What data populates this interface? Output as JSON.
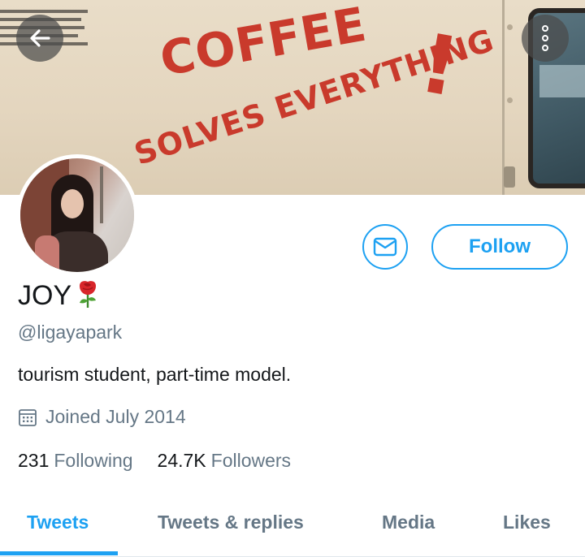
{
  "banner": {
    "slogan_line1": "COFFEE",
    "slogan_line2": "SOLVES EVERYTHING",
    "slogan_mark": "!",
    "slogan_color": "#c93a2c"
  },
  "nav": {
    "back_icon": "arrow-left-icon",
    "more_icon": "more-vertical-icon"
  },
  "profile": {
    "name": "JOY",
    "name_emoji_icon": "rose-icon",
    "handle": "@ligayapark",
    "bio": "tourism student, part-time model.",
    "joined": "Joined July 2014",
    "following_count": "231",
    "following_label": "Following",
    "followers_count": "24.7K",
    "followers_label": "Followers"
  },
  "actions": {
    "message_icon": "envelope-icon",
    "follow_label": "Follow"
  },
  "tabs": [
    {
      "label": "Tweets",
      "active": true
    },
    {
      "label": "Tweets & replies",
      "active": false
    },
    {
      "label": "Media",
      "active": false
    },
    {
      "label": "Likes",
      "active": false
    }
  ],
  "colors": {
    "accent": "#1da1f2",
    "secondary_text": "#657786",
    "primary_text": "#14171a"
  }
}
